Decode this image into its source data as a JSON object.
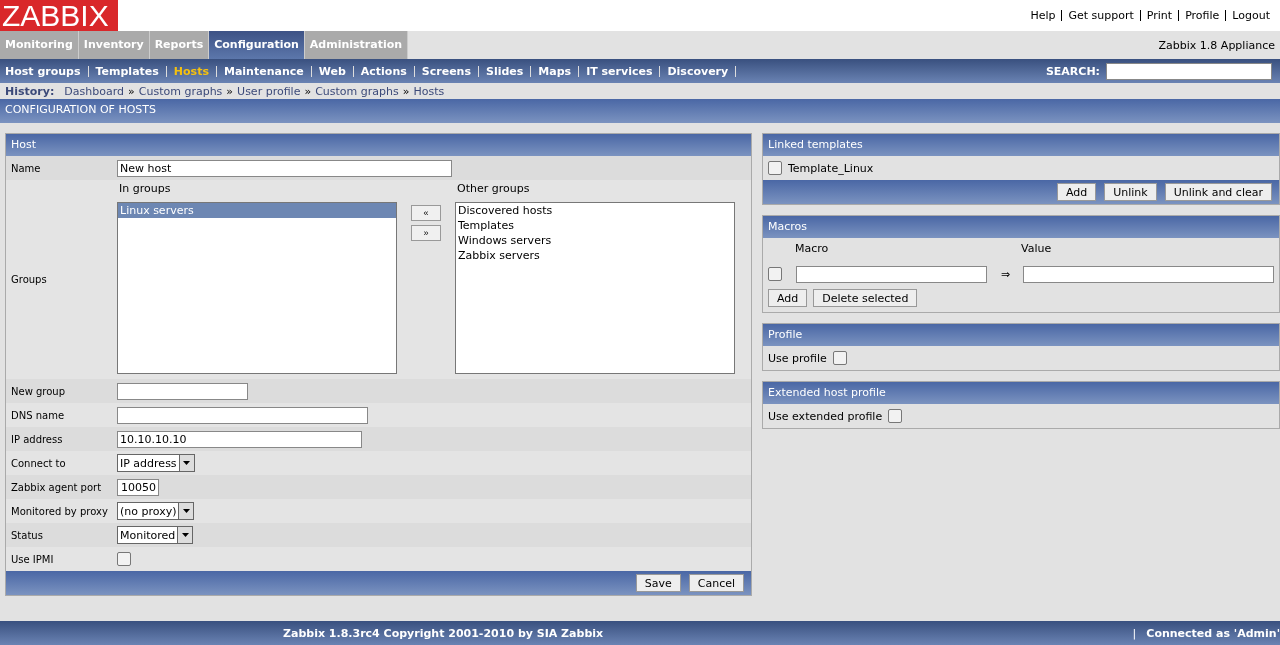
{
  "header": {
    "logo": "ZABBIX",
    "top_links": [
      "Help",
      "Get support",
      "Print",
      "Profile",
      "Logout"
    ]
  },
  "main_tabs": [
    {
      "label": "Monitoring",
      "selected": false
    },
    {
      "label": "Inventory",
      "selected": false
    },
    {
      "label": "Reports",
      "selected": false
    },
    {
      "label": "Configuration",
      "selected": true
    },
    {
      "label": "Administration",
      "selected": false
    }
  ],
  "appliance": "Zabbix 1.8 Appliance",
  "sub_nav": [
    {
      "label": "Host groups",
      "selected": false
    },
    {
      "label": "Templates",
      "selected": false
    },
    {
      "label": "Hosts",
      "selected": true
    },
    {
      "label": "Maintenance",
      "selected": false
    },
    {
      "label": "Web",
      "selected": false
    },
    {
      "label": "Actions",
      "selected": false
    },
    {
      "label": "Screens",
      "selected": false
    },
    {
      "label": "Slides",
      "selected": false
    },
    {
      "label": "Maps",
      "selected": false
    },
    {
      "label": "IT services",
      "selected": false
    },
    {
      "label": "Discovery",
      "selected": false
    }
  ],
  "search": {
    "label": "SEARCH:"
  },
  "history": {
    "label": "History:",
    "separator": "»",
    "items": [
      "Dashboard",
      "Custom graphs",
      "User profile",
      "Custom graphs",
      "Hosts"
    ]
  },
  "page_title": "CONFIGURATION OF HOSTS",
  "host_form": {
    "title": "Host",
    "rows": [
      {
        "kind": "text",
        "label": "Name",
        "value": "New host"
      },
      {
        "kind": "groups",
        "label": "Groups",
        "in_groups": {
          "title": "In groups",
          "items": [
            {
              "label": "Linux servers",
              "selected": true
            }
          ]
        },
        "move_left": "«",
        "move_right": "»",
        "other_groups": {
          "title": "Other groups",
          "items": [
            {
              "label": "Discovered hosts",
              "selected": false
            },
            {
              "label": "Templates",
              "selected": false
            },
            {
              "label": "Windows servers",
              "selected": false
            },
            {
              "label": "Zabbix servers",
              "selected": false
            }
          ]
        }
      },
      {
        "kind": "text",
        "label": "New group"
      },
      {
        "kind": "text",
        "label": "DNS name"
      },
      {
        "kind": "text",
        "label": "IP address",
        "value": "10.10.10.10"
      },
      {
        "kind": "select",
        "label": "Connect to",
        "value": "IP address"
      },
      {
        "kind": "text",
        "label": "Zabbix agent port",
        "value": "10050"
      },
      {
        "kind": "select",
        "label": "Monitored by proxy",
        "value": "(no proxy)"
      },
      {
        "kind": "select",
        "label": "Status",
        "value": "Monitored"
      },
      {
        "kind": "checkbox",
        "label": "Use IPMI",
        "checked": false
      }
    ],
    "buttons": [
      "Save",
      "Cancel"
    ]
  },
  "linked_templates": {
    "title": "Linked templates",
    "items": [
      {
        "label": "Template_Linux",
        "checked": false
      }
    ],
    "buttons": [
      "Add",
      "Unlink",
      "Unlink and clear"
    ]
  },
  "macros": {
    "title": "Macros",
    "columns": [
      "Macro",
      "Value"
    ],
    "rows": [
      {
        "checked": false,
        "arrow": "⇒"
      }
    ],
    "buttons": [
      "Add",
      "Delete selected"
    ]
  },
  "profile": {
    "title": "Profile",
    "label": "Use profile",
    "checked": false
  },
  "extended_profile": {
    "title": "Extended host profile",
    "label": "Use extended profile",
    "checked": false
  },
  "footer": {
    "copyright": "Zabbix 1.8.3rc4 Copyright 2001-2010 by SIA Zabbix",
    "separator": "|",
    "connected": "Connected as 'Admin'"
  }
}
